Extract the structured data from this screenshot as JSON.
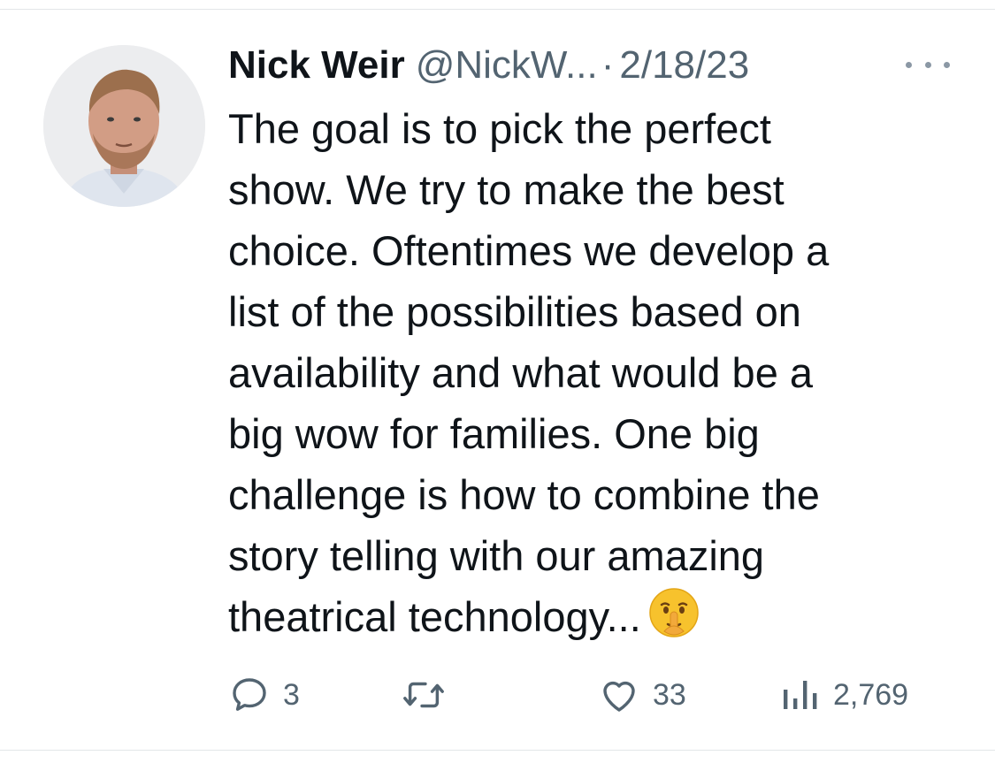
{
  "tweet": {
    "author_name": "Nick Weir",
    "handle": "@NickW...",
    "separator": "·",
    "date": "2/18/23",
    "body_lines": [
      "The goal is to pick the perfect",
      "show. We try to make the best",
      "choice. Oftentimes we develop a",
      "list of the possibilities based on",
      "availability and what would be a",
      "big wow for families. One big",
      "challenge is how to combine the",
      "story telling with our amazing",
      "theatrical technology..."
    ],
    "emoji": "shushing-face-emoji"
  },
  "actions": {
    "replies": "3",
    "retweets": "",
    "likes": "33",
    "views": "2,769"
  },
  "icons": {
    "more": "more-options-icon",
    "reply": "reply-icon",
    "retweet": "retweet-icon",
    "like": "heart-icon",
    "views": "views-chart-icon"
  },
  "colors": {
    "text_primary": "#0f1419",
    "text_secondary": "#536471",
    "divider": "#e3e6e8"
  }
}
